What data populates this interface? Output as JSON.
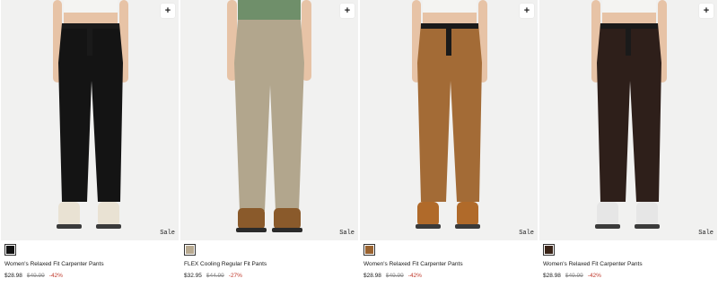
{
  "products": [
    {
      "name": "Women's Relaxed Fit Carpenter Pants",
      "sale_price": "$28.98",
      "original_price": "$49.99",
      "discount": "-42%",
      "badge": "Sale",
      "wishlist_icon": "plus-icon",
      "wishlist_symbol": "+",
      "swatch_color": "#111111",
      "pants_color": "#141414",
      "shoe_color": "#e9e2d3",
      "figure": "woman"
    },
    {
      "name": "FLEX Cooling Regular Fit Pants",
      "sale_price": "$32.95",
      "original_price": "$44.99",
      "discount": "-27%",
      "badge": "Sale",
      "wishlist_icon": "plus-icon",
      "wishlist_symbol": "+",
      "swatch_color": "#b9ab92",
      "pants_color": "#b2a68d",
      "shoe_color": "#8a5a2b",
      "figure": "man"
    },
    {
      "name": "Women's Relaxed Fit Carpenter Pants",
      "sale_price": "$28.98",
      "original_price": "$49.99",
      "discount": "-42%",
      "badge": "Sale",
      "wishlist_icon": "plus-icon",
      "wishlist_symbol": "+",
      "swatch_color": "#9a6330",
      "pants_color": "#a36b36",
      "shoe_color": "#b06a2a",
      "figure": "woman"
    },
    {
      "name": "Women's Relaxed Fit Carpenter Pants",
      "sale_price": "$28.98",
      "original_price": "$49.99",
      "discount": "-42%",
      "badge": "Sale",
      "wishlist_icon": "plus-icon",
      "wishlist_symbol": "+",
      "swatch_color": "#3a2418",
      "pants_color": "#2e1f1a",
      "shoe_color": "#e6e6e6",
      "figure": "woman"
    }
  ]
}
